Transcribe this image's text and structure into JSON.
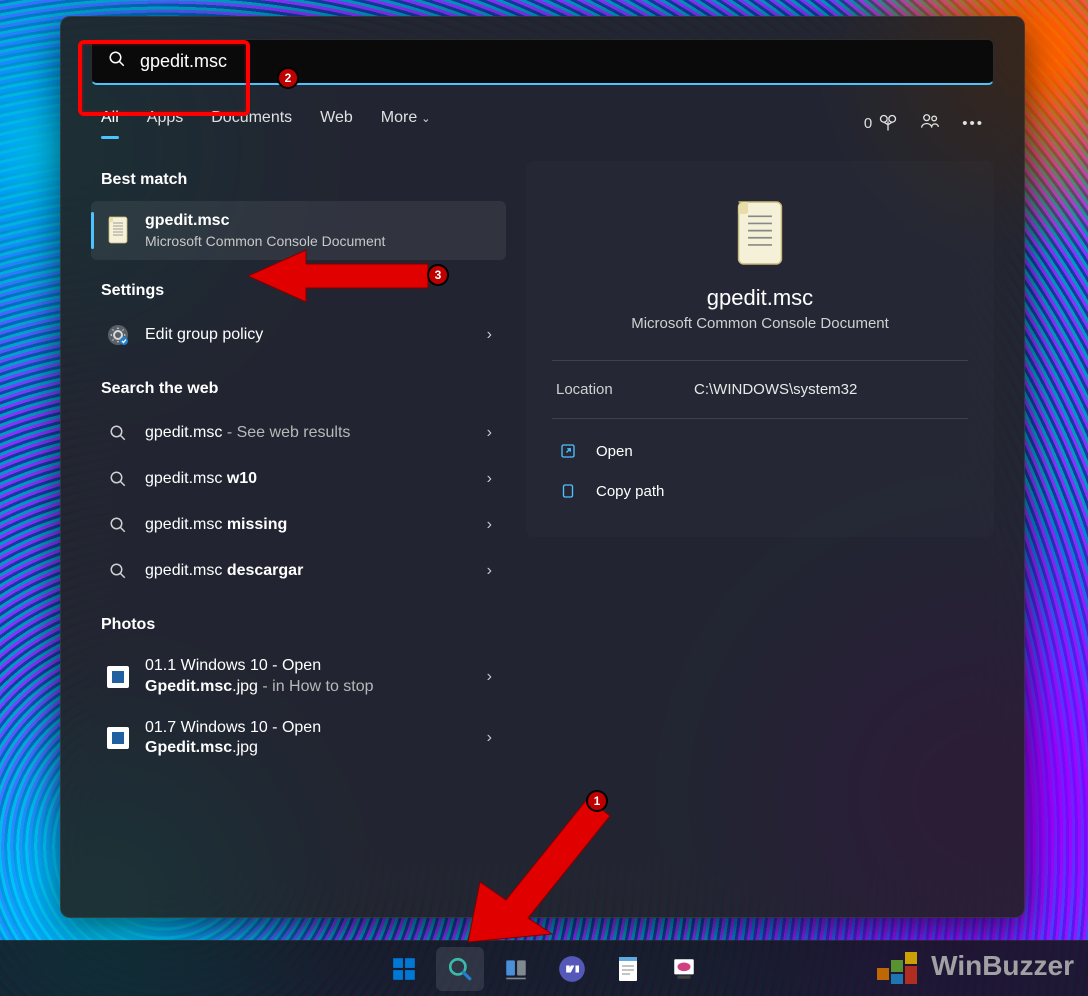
{
  "search": {
    "query": "gpedit.msc"
  },
  "tabs": {
    "all": "All",
    "apps": "Apps",
    "documents": "Documents",
    "web": "Web",
    "more": "More"
  },
  "rewards_count": "0",
  "sections": {
    "best_match": "Best match",
    "settings": "Settings",
    "search_web": "Search the web",
    "photos": "Photos"
  },
  "best_match": {
    "title": "gpedit.msc",
    "subtitle": "Microsoft Common Console Document"
  },
  "settings_items": {
    "0": {
      "label": "Edit group policy"
    }
  },
  "web_items": {
    "0": {
      "prefix": "gpedit.msc",
      "suffix": " - See web results"
    },
    "1": {
      "prefix": "gpedit.msc ",
      "bold": "w10"
    },
    "2": {
      "prefix": "gpedit.msc ",
      "bold": "missing"
    },
    "3": {
      "prefix": "gpedit.msc ",
      "bold": "descargar"
    }
  },
  "photo_items": {
    "0": {
      "line1": "01.1 Windows 10 - Open",
      "line2a": "Gpedit.msc",
      "line2b": ".jpg",
      "line2c": " - in How to stop"
    },
    "1": {
      "line1": "01.7 Windows 10 - Open",
      "line2a": "Gpedit.msc",
      "line2b": ".jpg"
    }
  },
  "detail": {
    "title": "gpedit.msc",
    "subtitle": "Microsoft Common Console Document",
    "location_label": "Location",
    "location_value": "C:\\WINDOWS\\system32",
    "actions": {
      "open": "Open",
      "copy": "Copy path"
    }
  },
  "watermark": "WinBuzzer",
  "annotations": {
    "b1": "1",
    "b2": "2",
    "b3": "3"
  }
}
